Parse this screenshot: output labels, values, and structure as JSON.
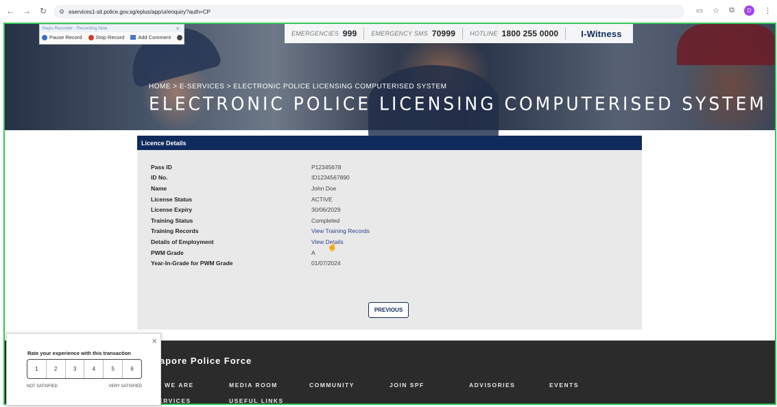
{
  "browser": {
    "url": "eservices1-sit.police.gov.sg/eplus/app/ui/enquiry?auth=CP",
    "profile_initial": "D"
  },
  "recorder": {
    "title": "Steps Recorder - Recording Now",
    "pause": "Pause Record",
    "stop": "Stop Record",
    "comment": "Add Comment"
  },
  "header": {
    "emergencies_label": "EMERGENCIES",
    "emergencies_number": "999",
    "sms_label": "EMERGENCY SMS",
    "sms_number": "70999",
    "hotline_label": "HOTLINE",
    "hotline_number": "1800 255 0000",
    "iwitness": "I-Witness",
    "breadcrumb": "HOME > E-SERVICES > ELECTRONIC POLICE LICENSING COMPUTERISED SYSTEM",
    "title": "ELECTRONIC POLICE LICENSING COMPUTERISED SYSTEM"
  },
  "panel": {
    "heading": "Licence Details",
    "rows": [
      {
        "label": "Pass ID",
        "value": "P12345678"
      },
      {
        "label": "ID No.",
        "value": "ID1234567890"
      },
      {
        "label": "Name",
        "value": "John Doe"
      },
      {
        "label": "License Status",
        "value": "ACTIVE"
      },
      {
        "label": "License Expiry",
        "value": "30/06/2029"
      },
      {
        "label": "Training Status",
        "value": "Completed"
      },
      {
        "label": "Training Records",
        "value": "View Training Records"
      },
      {
        "label": "Details of Employment",
        "value": "View Details"
      },
      {
        "label": "PWM Grade",
        "value": "A"
      },
      {
        "label": "Year-In-Grade for PWM Grade",
        "value": "01/07/2024"
      }
    ],
    "previous_button": "PREVIOUS"
  },
  "footer": {
    "brand": "ngapore Police Force",
    "nav": [
      "O WE ARE",
      "MEDIA ROOM",
      "COMMUNITY",
      "JOIN SPF",
      "ADVISORIES",
      "EVENTS",
      "ERVICES",
      "USEFUL LINKS"
    ]
  },
  "rating": {
    "question": "Rate your experience with this transaction",
    "options": [
      "1",
      "2",
      "3",
      "4",
      "5",
      "6"
    ],
    "low_label": "NOT SATISFIED",
    "high_label": "VERY SATISFIED",
    "close": "×"
  },
  "colors": {
    "navy": "#0f2a5c",
    "frame_green": "#34c759",
    "panel_bg": "#e9e9ea",
    "footer_bg": "#2b2b2b"
  }
}
